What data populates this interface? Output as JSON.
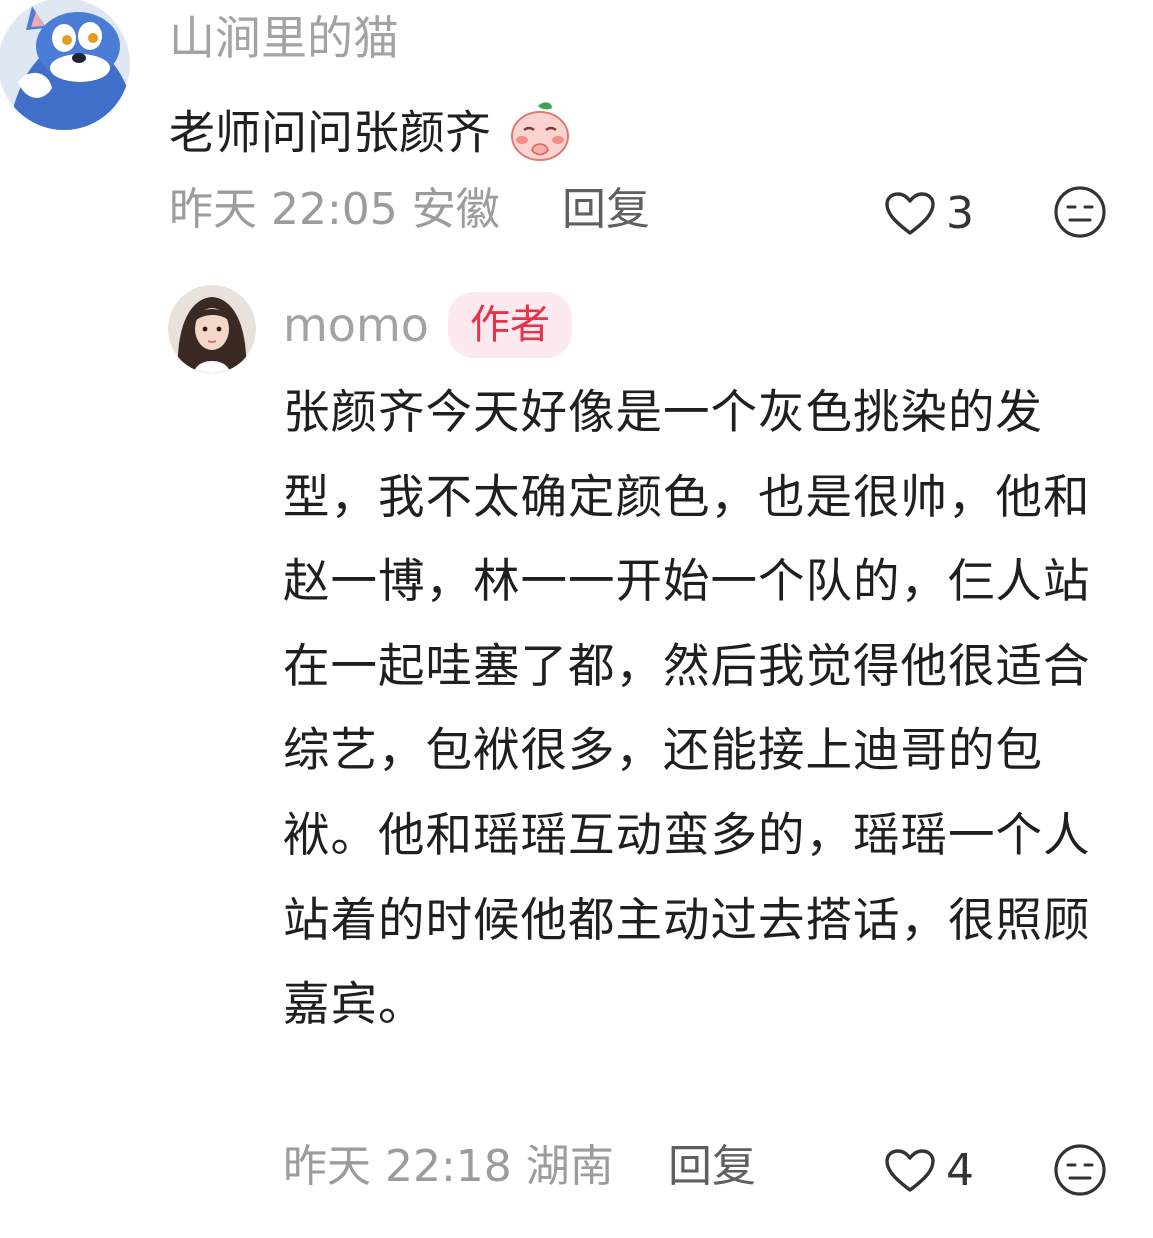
{
  "comments": [
    {
      "username": "山涧里的猫",
      "text": "老师问问张颜齐",
      "emoji_icon": "shy-peach-emoji-icon",
      "time": "昨天 22:05",
      "location": "安徽",
      "reply_label": "回复",
      "likes": "3"
    }
  ],
  "reply": {
    "username": "momo",
    "badge": "作者",
    "text": "张颜齐今天好像是一个灰色挑染的发型，我不太确定颜色，也是很帅，他和赵一博，林一一开始一个队的，仨人站在一起哇塞了都，然后我觉得他很适合综艺，包袱很多，还能接上迪哥的包袱。他和瑶瑶互动蛮多的，瑶瑶一个人站着的时候他都主动过去搭话，很照顾嘉宾。",
    "time": "昨天 22:18",
    "location": "湖南",
    "reply_label": "回复",
    "likes": "4"
  },
  "colors": {
    "username": "#a3a3a3",
    "meta": "#9c9c9c",
    "badge_bg": "#fdeaee",
    "badge_text": "#e8324b"
  }
}
